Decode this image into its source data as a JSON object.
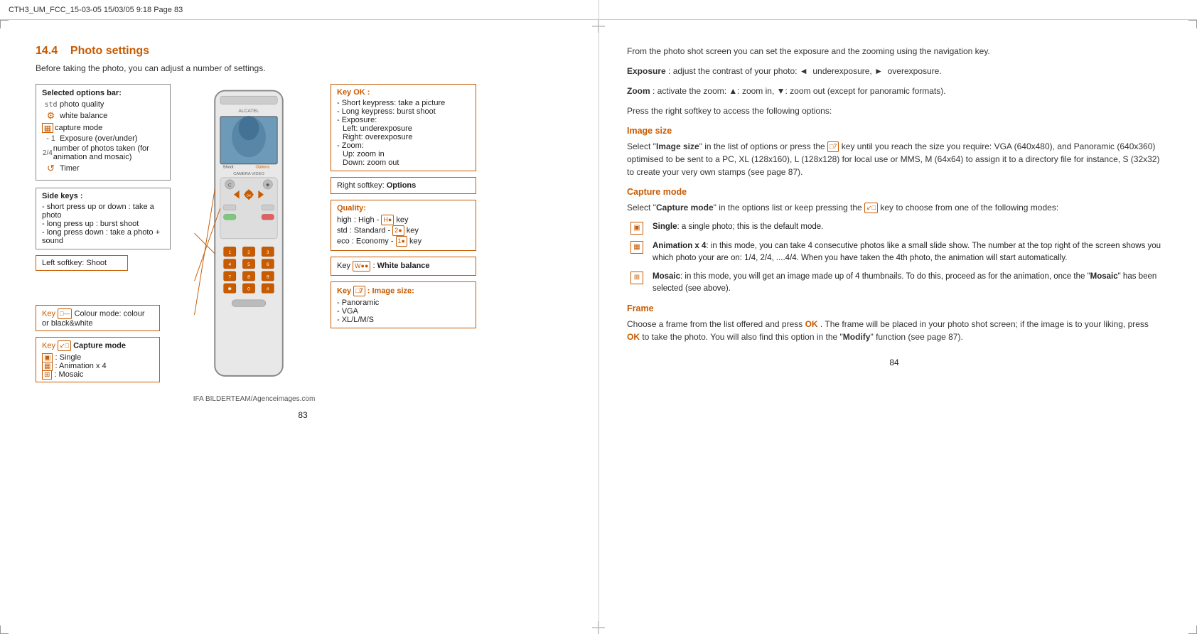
{
  "header": {
    "text": "CTH3_UM_FCC_15-03-05   15/03/05   9:18   Page 83"
  },
  "left_page": {
    "section": "14.4  Photo settings",
    "section_number": "14.4",
    "section_title": "Photo settings",
    "intro": "Before taking the photo, you can adjust a number of settings.",
    "options_bar": {
      "title": "Selected options bar:",
      "items": [
        {
          "icon": "std",
          "label": "photo quality"
        },
        {
          "icon": "⚙",
          "label": "white balance"
        },
        {
          "icon": "🎞",
          "label": "capture mode"
        },
        {
          "icon": "- 1",
          "label": "Exposure (over/under)"
        },
        {
          "icon": "2/4",
          "label": "number of photos taken (for animation and mosaic)"
        },
        {
          "icon": "↺",
          "label": "Timer"
        }
      ]
    },
    "side_keys": {
      "title": "Side keys :",
      "items": [
        "- short press up or down : take a photo",
        "- long press up : burst shoot",
        "- long press down : take a photo + sound"
      ]
    },
    "left_softkey": "Left softkey: Shoot",
    "colour_mode": {
      "key_label": "Key",
      "key_icon": "□—",
      "text": "Colour mode: colour or black&white"
    },
    "capture_mode": {
      "key_label": "Key",
      "key_icon": "↙□",
      "title": "Capture mode",
      "items": [
        "□ : Single",
        "🎞 : Animation x 4",
        "⊞ : Mosaic"
      ]
    },
    "caption": "IFA BILDERTEAM/Agenceimages.com",
    "page_number": "83"
  },
  "right_callouts": {
    "key_ok": {
      "title": "Key OK :",
      "items": [
        "- Short keypress: take a picture",
        "- Long keypress: burst shoot",
        "- Exposure:",
        "  Left: underexposure",
        "  Right: overexposure",
        "- Zoom:",
        "  Up: zoom in",
        "  Down: zoom out"
      ]
    },
    "right_softkey": "Right softkey: Options",
    "quality": {
      "title": "Quality:",
      "items": [
        "high : High - [H●] key",
        "std  : Standard - [2●] key",
        "eco  : Economy - [1●] key"
      ]
    },
    "white_balance": "Key [W●●] : White balance",
    "image_size": {
      "title": "Key [□7] : Image size:",
      "items": [
        "- Panoramic",
        "- VGA",
        "- XL/L/M/S"
      ]
    }
  },
  "right_page": {
    "intro": "From the photo shot screen you can set the exposure and the zooming using the navigation key.",
    "exposure": {
      "label": "Exposure",
      "text": ": adjust the contrast of your photo: ◄  underexposure, ►  overexposure."
    },
    "zoom": {
      "label": "Zoom",
      "text": ": activate the zoom: ▲: zoom in, ▼: zoom out (except for panoramic formats)."
    },
    "press_softkey": "Press the right softkey to access the following options:",
    "image_size": {
      "heading": "Image size",
      "text": "Select \"Image size\" in the list of options or press the  key until you reach the size you require: VGA (640x480), and Panoramic (640x360) optimised to be sent to a PC, XL (128x160), L (128x128) for local use or MMS, M (64x64) to assign it to a directory file for instance, S (32x32) to create your very own stamps (see page 87)."
    },
    "capture_mode": {
      "heading": "Capture mode",
      "intro": "Select \"Capture mode\" in the options list or keep pressing the  key to choose from one of the following modes:",
      "modes": [
        {
          "icon": "single",
          "label": "Single",
          "text": ": a single photo; this is the default mode."
        },
        {
          "icon": "animation",
          "label": "Animation x 4",
          "text": ": in this mode, you can take 4 consecutive photos like a small slide show. The number at the top right of the screen shows you which photo your are on: 1/4, 2/4, ....4/4. When you have taken the 4th photo, the animation will start automatically."
        },
        {
          "icon": "mosaic",
          "label": "Mosaic",
          "text": ": in this mode, you will get an image made up of 4 thumbnails. To do this, proceed as for the animation, once the \"Mosaic\" has been selected (see above)."
        }
      ]
    },
    "frame": {
      "heading": "Frame",
      "text": "Choose a frame from the list offered and press OK . The frame will be placed in your photo shot screen; if the image is to your liking, press OK  to take the photo. You will also find this option in the \"Modify\" function (see page 87)."
    },
    "page_number": "84"
  }
}
